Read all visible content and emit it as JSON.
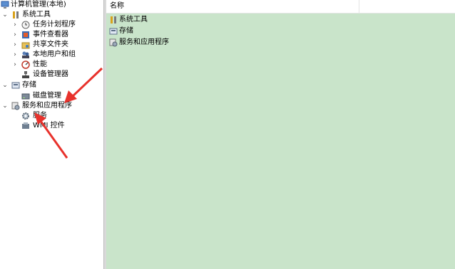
{
  "tree": {
    "root": {
      "label": "计算机管理(本地)",
      "icon": "computer-management-icon"
    },
    "system_tools": {
      "label": "系统工具",
      "icon": "tools-icon",
      "chevron": "⌄",
      "children": [
        {
          "label": "任务计划程序",
          "icon": "clock-icon",
          "chevron": "›"
        },
        {
          "label": "事件查看器",
          "icon": "event-viewer-icon",
          "chevron": "›"
        },
        {
          "label": "共享文件夹",
          "icon": "shared-folder-icon",
          "chevron": "›"
        },
        {
          "label": "本地用户和组",
          "icon": "users-icon",
          "chevron": "›"
        },
        {
          "label": "性能",
          "icon": "performance-icon",
          "chevron": "›"
        },
        {
          "label": "设备管理器",
          "icon": "device-manager-icon",
          "chevron": ""
        }
      ]
    },
    "storage": {
      "label": "存储",
      "icon": "storage-icon",
      "chevron": "⌄",
      "children": [
        {
          "label": "磁盘管理",
          "icon": "disk-icon"
        }
      ]
    },
    "services_apps": {
      "label": "服务和应用程序",
      "icon": "services-apps-icon",
      "chevron": "⌄",
      "children": [
        {
          "label": "服务",
          "icon": "gear-icon"
        },
        {
          "label": "WMI 控件",
          "icon": "wmi-icon"
        }
      ]
    }
  },
  "list": {
    "column_name": "名称",
    "items": [
      {
        "label": "系统工具",
        "icon": "tools-icon"
      },
      {
        "label": "存储",
        "icon": "storage-icon"
      },
      {
        "label": "服务和应用程序",
        "icon": "services-apps-icon"
      }
    ]
  },
  "colors": {
    "list_background": "#c9e4ca",
    "annotation_arrow": "#e8322c"
  }
}
